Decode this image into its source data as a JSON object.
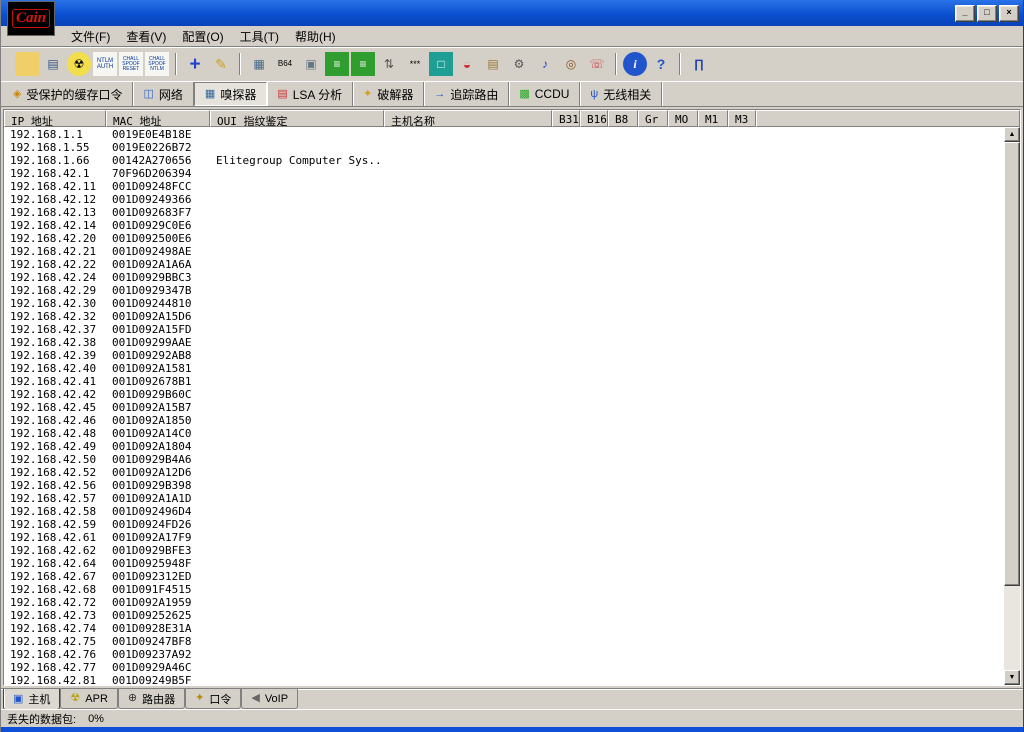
{
  "window": {
    "title": "",
    "controls": [
      {
        "name": "minimize-button",
        "glyph": "_"
      },
      {
        "name": "maximize-button",
        "glyph": "□"
      },
      {
        "name": "close-button",
        "glyph": "×"
      }
    ]
  },
  "logo": {
    "text": "Cain"
  },
  "menu": {
    "items": [
      {
        "name": "menu-file",
        "label": "文件(F)"
      },
      {
        "name": "menu-view",
        "label": "查看(V)"
      },
      {
        "name": "menu-configure",
        "label": "配置(O)"
      },
      {
        "name": "menu-tools",
        "label": "工具(T)"
      },
      {
        "name": "menu-help",
        "label": "帮助(H)"
      }
    ]
  },
  "toolbar": {
    "icons": [
      {
        "name": "open-file-icon",
        "glyph": "",
        "bg": "#f0cf6a"
      },
      {
        "name": "export-icon",
        "glyph": "▤",
        "fg": "#335588"
      },
      {
        "name": "start-sniffer-icon",
        "glyph": "☢",
        "fg": "#000000",
        "bg": "#f3de4e",
        "round": true
      },
      {
        "name": "ntlm-auth-icon",
        "glyph": "NTLM AUTH",
        "fg": "#003399",
        "bg": "#f6f6f2",
        "fs": "6px"
      },
      {
        "name": "chall-spoof-reset-icon",
        "glyph": "CHALL SPOOF RESET",
        "fg": "#003399",
        "bg": "#f6f6f2",
        "fs": "5px"
      },
      {
        "name": "chall-spoof-ntlm-icon",
        "glyph": "CHALL SPOOF NTLM",
        "fg": "#003399",
        "bg": "#f6f6f2",
        "fs": "5px"
      },
      {
        "sep": true
      },
      {
        "name": "add-to-list-icon",
        "glyph": "+",
        "fg": "#2244cc",
        "fs": "19px",
        "bold": true
      },
      {
        "name": "note-edit-icon",
        "glyph": "✎",
        "fg": "#c8a020",
        "fs": "14px"
      },
      {
        "sep": true
      },
      {
        "name": "network-adapter-icon",
        "glyph": "▦",
        "fg": "#446688"
      },
      {
        "name": "base64-icon",
        "glyph": "B64",
        "fg": "#000000",
        "fs": "8px"
      },
      {
        "name": "certificate-icon",
        "glyph": "▣",
        "fg": "#667788"
      },
      {
        "name": "hash-calculator-icon",
        "glyph": "≡",
        "fg": "#ffffff",
        "bg": "#2f9e2f"
      },
      {
        "name": "hash-calculator-2-icon",
        "glyph": "≡",
        "fg": "#ffffff",
        "bg": "#2f9e2f"
      },
      {
        "name": "arp-spoof-icon",
        "glyph": "⇅",
        "fg": "#555555"
      },
      {
        "name": "wordlist-icon",
        "glyph": "***",
        "fg": "#000000",
        "fs": "9px"
      },
      {
        "name": "remote-desktop-icon",
        "glyph": "□",
        "fg": "#ffffff",
        "bg": "#1f9e96"
      },
      {
        "name": "cisco-config-icon",
        "glyph": "◒",
        "fg": "#cc3333",
        "fs": "14px"
      },
      {
        "name": "box-upload-icon",
        "glyph": "▤",
        "fg": "#997733"
      },
      {
        "name": "services-icon",
        "glyph": "⚙",
        "fg": "#555555"
      },
      {
        "name": "audio-icon",
        "glyph": "♪",
        "fg": "#2244cc"
      },
      {
        "name": "query-icon",
        "glyph": "◎",
        "fg": "#885522"
      },
      {
        "name": "messenger-icon",
        "glyph": "☏",
        "fg": "#cc4444"
      },
      {
        "sep": true
      },
      {
        "name": "info-icon",
        "glyph": "i",
        "fg": "#ffffff",
        "bg": "#2255cc",
        "round": true,
        "italic": true,
        "bold": true
      },
      {
        "name": "help-icon",
        "glyph": "?",
        "fg": "#2255cc",
        "fs": "14px",
        "bold": true
      },
      {
        "sep": true
      },
      {
        "name": "exit-icon",
        "glyph": "∏",
        "fg": "#2244aa",
        "bold": true
      }
    ]
  },
  "view_tabs": {
    "items": [
      {
        "name": "tab-protected-passwords",
        "icon_name": "decoder-icon",
        "label": "受保护的缓存口令",
        "glyph": "◈",
        "ic": "#cc8800"
      },
      {
        "name": "tab-network",
        "icon_name": "network-icon",
        "label": "网络",
        "glyph": "◫",
        "ic": "#3366cc"
      },
      {
        "name": "tab-sniffer",
        "icon_name": "sniffer-card-icon",
        "label": "嗅探器",
        "glyph": "▦",
        "ic": "#336699",
        "active": true
      },
      {
        "name": "tab-lsa",
        "icon_name": "lsa-book-icon",
        "label": "LSA 分析",
        "glyph": "▤",
        "ic": "#cc3333"
      },
      {
        "name": "tab-cracker",
        "icon_name": "cracker-key-icon",
        "label": "破解器",
        "glyph": "✦",
        "ic": "#d4a017"
      },
      {
        "name": "tab-traceroute",
        "icon_name": "traceroute-icon",
        "label": "追踪路由",
        "glyph": "→",
        "ic": "#2255cc"
      },
      {
        "name": "tab-ccdu",
        "icon_name": "ccdu-icon",
        "label": "CCDU",
        "glyph": "▩",
        "ic": "#22aa22"
      },
      {
        "name": "tab-wireless",
        "icon_name": "wireless-antenna-icon",
        "label": "无线相关",
        "glyph": "ψ",
        "ic": "#2255cc"
      }
    ]
  },
  "table": {
    "columns": [
      "IP 地址",
      "MAC 地址",
      "OUI 指纹鉴定",
      "主机名称",
      "B31",
      "B16",
      "B8",
      "Gr",
      "MO",
      "M1",
      "M3"
    ],
    "rows": [
      {
        "ip": "192.168.1.1",
        "mac": "0019E0E4B18E"
      },
      {
        "ip": "192.168.1.55",
        "mac": "0019E0226B72"
      },
      {
        "ip": "192.168.1.66",
        "mac": "00142A270656",
        "oui": "Elitegroup Computer Sys..."
      },
      {
        "ip": "192.168.42.1",
        "mac": "70F96D206394"
      },
      {
        "ip": "192.168.42.11",
        "mac": "001D09248FCC"
      },
      {
        "ip": "192.168.42.12",
        "mac": "001D09249366"
      },
      {
        "ip": "192.168.42.13",
        "mac": "001D092683F7"
      },
      {
        "ip": "192.168.42.14",
        "mac": "001D0929C0E6"
      },
      {
        "ip": "192.168.42.20",
        "mac": "001D092500E6"
      },
      {
        "ip": "192.168.42.21",
        "mac": "001D092498AE"
      },
      {
        "ip": "192.168.42.22",
        "mac": "001D092A1A6A"
      },
      {
        "ip": "192.168.42.24",
        "mac": "001D0929BBC3"
      },
      {
        "ip": "192.168.42.29",
        "mac": "001D0929347B"
      },
      {
        "ip": "192.168.42.30",
        "mac": "001D09244810"
      },
      {
        "ip": "192.168.42.32",
        "mac": "001D092A15D6"
      },
      {
        "ip": "192.168.42.37",
        "mac": "001D092A15FD"
      },
      {
        "ip": "192.168.42.38",
        "mac": "001D09299AAE"
      },
      {
        "ip": "192.168.42.39",
        "mac": "001D09292AB8"
      },
      {
        "ip": "192.168.42.40",
        "mac": "001D092A1581"
      },
      {
        "ip": "192.168.42.41",
        "mac": "001D092678B1"
      },
      {
        "ip": "192.168.42.42",
        "mac": "001D0929B60C"
      },
      {
        "ip": "192.168.42.45",
        "mac": "001D092A15B7"
      },
      {
        "ip": "192.168.42.46",
        "mac": "001D092A1850"
      },
      {
        "ip": "192.168.42.48",
        "mac": "001D092A14C0"
      },
      {
        "ip": "192.168.42.49",
        "mac": "001D092A1804"
      },
      {
        "ip": "192.168.42.50",
        "mac": "001D0929B4A6"
      },
      {
        "ip": "192.168.42.52",
        "mac": "001D092A12D6"
      },
      {
        "ip": "192.168.42.56",
        "mac": "001D0929B398"
      },
      {
        "ip": "192.168.42.57",
        "mac": "001D092A1A1D"
      },
      {
        "ip": "192.168.42.58",
        "mac": "001D092496D4"
      },
      {
        "ip": "192.168.42.59",
        "mac": "001D0924FD26"
      },
      {
        "ip": "192.168.42.61",
        "mac": "001D092A17F9"
      },
      {
        "ip": "192.168.42.62",
        "mac": "001D0929BFE3"
      },
      {
        "ip": "192.168.42.64",
        "mac": "001D0925948F"
      },
      {
        "ip": "192.168.42.67",
        "mac": "001D092312ED"
      },
      {
        "ip": "192.168.42.68",
        "mac": "001D091F4515"
      },
      {
        "ip": "192.168.42.72",
        "mac": "001D092A1959"
      },
      {
        "ip": "192.168.42.73",
        "mac": "001D09252625"
      },
      {
        "ip": "192.168.42.74",
        "mac": "001D0928E31A"
      },
      {
        "ip": "192.168.42.75",
        "mac": "001D09247BF8"
      },
      {
        "ip": "192.168.42.76",
        "mac": "001D09237A92"
      },
      {
        "ip": "192.168.42.77",
        "mac": "001D0929A46C"
      },
      {
        "ip": "192.168.42.81",
        "mac": "001D09249B5F"
      }
    ]
  },
  "scrollbar": {
    "up_glyph": "▲",
    "down_glyph": "▼"
  },
  "bottom_tabs": {
    "items": [
      {
        "name": "bottom-tab-hosts",
        "icon_name": "monitor-icon",
        "label": "主机",
        "glyph": "▣",
        "ic": "#2255cc",
        "active": true
      },
      {
        "name": "bottom-tab-apr",
        "icon_name": "radiation-icon",
        "label": "APR",
        "glyph": "☢",
        "ic": "#b8a000"
      },
      {
        "name": "bottom-tab-routing",
        "icon_name": "compass-icon",
        "label": "路由器",
        "glyph": "⊕",
        "ic": "#333333"
      },
      {
        "name": "bottom-tab-passwords",
        "icon_name": "key-icon",
        "label": "口令",
        "glyph": "✦",
        "ic": "#b8860b"
      },
      {
        "name": "bottom-tab-voip",
        "icon_name": "speaker-icon",
        "label": "VoIP",
        "glyph": "◀",
        "ic": "#666666"
      }
    ]
  },
  "status": {
    "label": "丢失的数据包:",
    "value": "0%"
  }
}
